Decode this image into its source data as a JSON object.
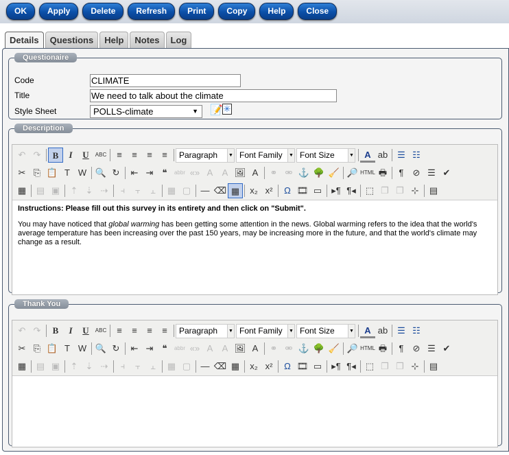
{
  "toolbar": {
    "buttons": [
      "OK",
      "Apply",
      "Delete",
      "Refresh",
      "Print",
      "Copy",
      "Help",
      "Close"
    ]
  },
  "tabs": [
    {
      "label": "Details",
      "active": true
    },
    {
      "label": "Questions"
    },
    {
      "label": "Help"
    },
    {
      "label": "Notes"
    },
    {
      "label": "Log"
    }
  ],
  "questionaire": {
    "legend": "Questionaire",
    "code_label": "Code",
    "code_value": "CLIMATE",
    "title_label": "Title",
    "title_value": "We need to talk about the climate",
    "style_label": "Style Sheet",
    "style_value": "POLLS-climate",
    "edit_icon": "pencil-edit-icon",
    "new_icon": "new-document-icon"
  },
  "description": {
    "legend": "Description",
    "instructions": "Instructions: Please fill out this survey in its entirety and then click on \"Submit\".",
    "body_before": "You may have noticed that ",
    "body_italic": "global warming",
    "body_after": " has been getting some attention in the news. Global warming refers to the idea that the world's average temperature has been increasing over the past 150 years, may be increasing more in the future, and that the world's climate may change as a result."
  },
  "thankyou": {
    "legend": "Thank You"
  },
  "editor": {
    "dropdowns": [
      "Paragraph",
      "Font Family",
      "Font Size"
    ],
    "rows": [
      [
        [
          "undo",
          "↶",
          1
        ],
        [
          "redo",
          "↷",
          1
        ],
        "|",
        [
          "bold",
          "B",
          0,
          1
        ],
        [
          "italic",
          "I"
        ],
        [
          "underline",
          "U"
        ],
        [
          "strikethrough",
          "ABC"
        ],
        "|",
        [
          "align-left",
          "≡"
        ],
        [
          "align-center",
          "≡"
        ],
        [
          "align-right",
          "≡"
        ],
        [
          "justify",
          "≡"
        ],
        "|",
        "DD",
        "|",
        [
          "text-color",
          "A"
        ],
        [
          "background-color",
          "ab"
        ],
        "|",
        [
          "bullet-list",
          "☰"
        ],
        [
          "numbered-list",
          "☷"
        ]
      ],
      [
        [
          "cut",
          "✂"
        ],
        [
          "copy",
          "⎘"
        ],
        [
          "paste",
          "📋"
        ],
        [
          "paste-text",
          "T"
        ],
        [
          "paste-word",
          "W"
        ],
        "|",
        [
          "find",
          "🔍"
        ],
        [
          "replace",
          "↻"
        ],
        "|",
        [
          "outdent",
          "⇤"
        ],
        [
          "indent",
          "⇥"
        ],
        [
          "blockquote",
          "❝"
        ],
        [
          "abbr",
          "abbr",
          1
        ],
        [
          "cite",
          "«»",
          1
        ],
        [
          "remove-format",
          "A",
          1
        ],
        [
          "styles",
          "A",
          1
        ],
        [
          "insert-image",
          "🖼"
        ],
        [
          "style-props",
          "A"
        ],
        "|",
        [
          "link",
          "⚭",
          1
        ],
        [
          "unlink",
          "⚮",
          1
        ],
        [
          "anchor",
          "⚓"
        ],
        [
          "image",
          "🌳"
        ],
        [
          "cleanup",
          "🧹"
        ],
        "|",
        [
          "preview",
          "🔎"
        ],
        [
          "html",
          "HTML"
        ],
        [
          "print",
          "🖶"
        ],
        "|",
        [
          "pilcrow",
          "¶"
        ],
        [
          "nonbreaking",
          "⊘"
        ],
        [
          "horizontal-rule",
          "☰"
        ],
        [
          "spellcheck",
          "✔"
        ]
      ],
      [
        [
          "table-props",
          "▦"
        ],
        "|",
        [
          "row-props",
          "▤",
          1
        ],
        [
          "cell-props",
          "▣",
          1
        ],
        "|",
        [
          "row-before",
          "⇡",
          1
        ],
        [
          "row-after",
          "⇣",
          1
        ],
        [
          "delete-row",
          "⇢",
          1
        ],
        "|",
        [
          "col-before",
          "⫞",
          1
        ],
        [
          "col-after",
          "⫟",
          1
        ],
        [
          "delete-col",
          "⫠",
          1
        ],
        "|",
        [
          "split-cells",
          "▦",
          1
        ],
        [
          "merge-cells",
          "▢",
          1
        ],
        "|",
        [
          "hr",
          "—"
        ],
        [
          "eraser",
          "⌫"
        ],
        [
          "insert-table",
          "▦",
          0,
          1
        ],
        "|",
        [
          "subscript",
          "x₂"
        ],
        [
          "superscript",
          "x²"
        ],
        "|",
        [
          "special-char",
          "Ω"
        ],
        [
          "media",
          "🎞"
        ],
        [
          "input-field",
          "▭"
        ],
        "|",
        [
          "ltr",
          "▸¶"
        ],
        [
          "rtl",
          "¶◂"
        ],
        "|",
        [
          "layer",
          "⬚"
        ],
        [
          "layer-forward",
          "❐",
          1
        ],
        [
          "layer-backward",
          "❐",
          1
        ],
        [
          "absolute",
          "⊹"
        ],
        "|",
        [
          "template",
          "▤"
        ]
      ]
    ]
  }
}
